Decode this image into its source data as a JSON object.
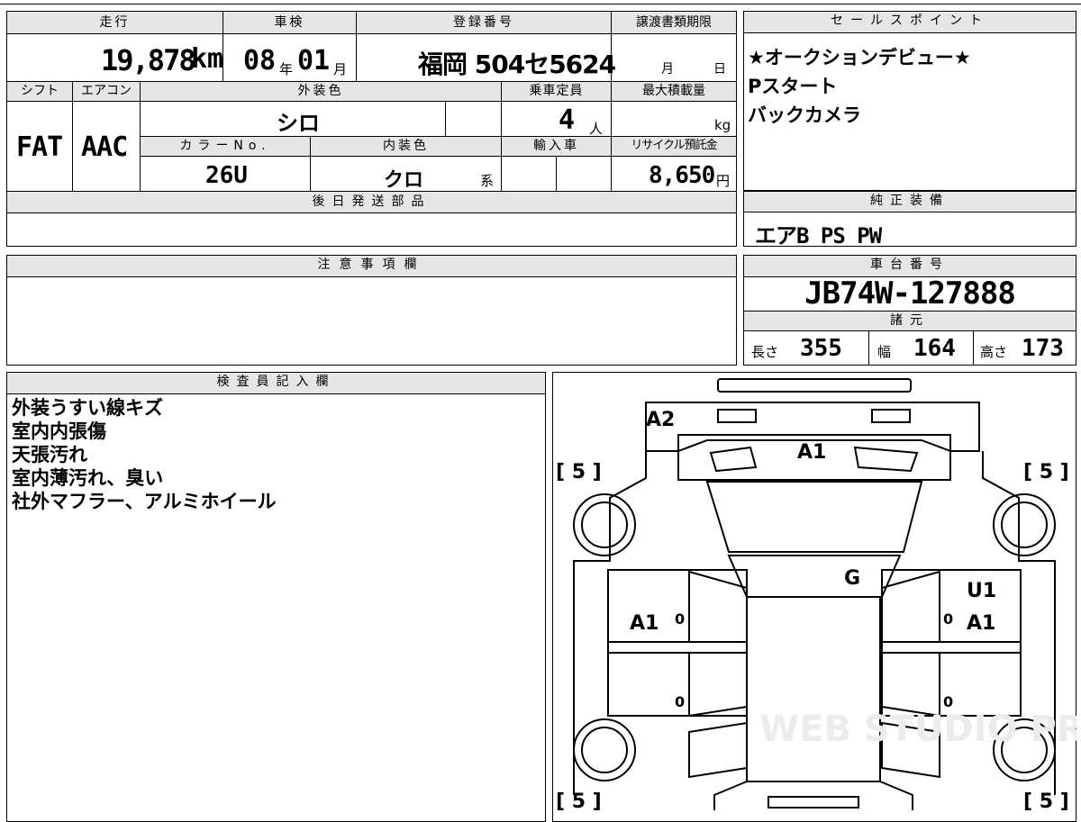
{
  "mileage": {
    "label": "走行",
    "value": "19,878",
    "unit": "km"
  },
  "inspection": {
    "label": "車検",
    "year": "08",
    "year_unit": "年",
    "month": "01",
    "month_unit": "月"
  },
  "registration": {
    "label": "登録番号",
    "value": "福岡 504セ5624"
  },
  "transfer_deadline": {
    "label": "譲渡書類期限",
    "month_unit": "月",
    "day_unit": "日"
  },
  "shift": {
    "label": "シフト",
    "value": "FAT"
  },
  "aircon": {
    "label": "エアコン",
    "value": "AAC"
  },
  "exterior_color": {
    "label": "外装色",
    "value": "シロ"
  },
  "capacity": {
    "label": "乗車定員",
    "value": "4",
    "unit": "人"
  },
  "max_load": {
    "label": "最大積載量",
    "unit": "kg"
  },
  "color_no": {
    "label": "カラーNo.",
    "value": "26U"
  },
  "interior_color": {
    "label": "内装色",
    "value": "クロ",
    "suffix": "系"
  },
  "import": {
    "label": "輸入車"
  },
  "recycle": {
    "label": "リサイクル預託金",
    "value": "8,650",
    "unit": "円"
  },
  "later_parts": {
    "label": "後日発送部品"
  },
  "sales_points": {
    "label": "セールスポイント",
    "items": [
      "★オークションデビュー★",
      "Pスタート",
      "バックカメラ"
    ]
  },
  "genuine_equipment": {
    "label": "純正装備",
    "value": "エアB PS PW"
  },
  "notes": {
    "label": "注意事項欄"
  },
  "chassis": {
    "label": "車台番号",
    "value": "JB74W-127888"
  },
  "specs": {
    "label": "諸元",
    "length_label": "長さ",
    "length": "355",
    "width_label": "幅",
    "width": "164",
    "height_label": "高さ",
    "height": "173"
  },
  "inspector": {
    "label": "検査員記入欄",
    "lines": [
      "外装うすい線キズ",
      "室内内張傷",
      "天張汚れ",
      "室内薄汚れ、臭い",
      "社外マフラー、アルミホイール"
    ]
  },
  "diagram": {
    "marks": {
      "hood": "A1",
      "front_left": "A2",
      "glass": "G",
      "left_door": "A1",
      "right_door_1": "U1",
      "right_door_2": "A1"
    },
    "tire_marks": [
      "[ 5 ]",
      "[ 5 ]",
      "[ 5 ]",
      "[ 5 ]"
    ],
    "door_zeros": [
      "0",
      "0",
      "0",
      "0"
    ],
    "watermark": "WEB STUDIO PRO"
  }
}
